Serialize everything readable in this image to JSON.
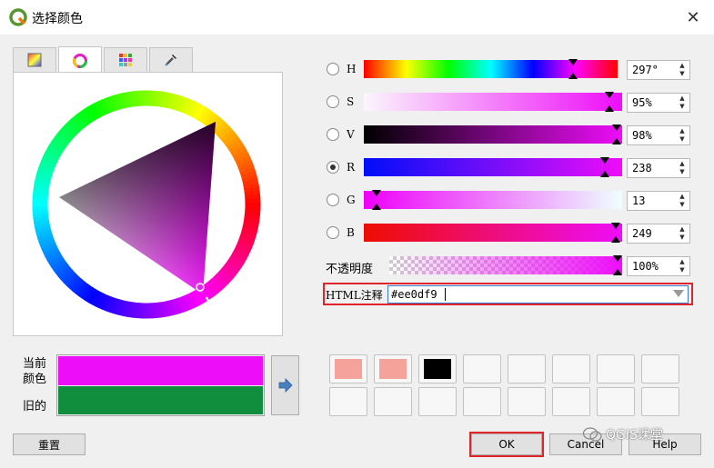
{
  "window": {
    "title": "选择颜色",
    "close_glyph": "✕"
  },
  "tabs": [
    {
      "name": "tab-ramp",
      "icon": "color-ramp-icon"
    },
    {
      "name": "tab-wheel",
      "icon": "color-wheel-icon",
      "active": true
    },
    {
      "name": "tab-swatches",
      "icon": "swatch-grid-icon"
    },
    {
      "name": "tab-picker",
      "icon": "eyedropper-icon"
    }
  ],
  "components": [
    {
      "key": "h",
      "label": "H",
      "value": "297°",
      "checked": false,
      "marker_fraction": 0.825
    },
    {
      "key": "s",
      "label": "S",
      "value": "95%",
      "checked": false,
      "marker_fraction": 0.95
    },
    {
      "key": "v",
      "label": "V",
      "value": "98%",
      "checked": false,
      "marker_fraction": 0.98
    },
    {
      "key": "r",
      "label": "R",
      "value": "238",
      "checked": true,
      "marker_fraction": 0.933
    },
    {
      "key": "g",
      "label": "G",
      "value": "13",
      "checked": false,
      "marker_fraction": 0.051
    },
    {
      "key": "b",
      "label": "B",
      "value": "249",
      "checked": false,
      "marker_fraction": 0.976
    }
  ],
  "opacity": {
    "label": "不透明度",
    "value": "100%",
    "fraction": 1.0
  },
  "html": {
    "label": "HTML注释",
    "value": "#ee0df9"
  },
  "preview": {
    "current_label_line1": "当前",
    "current_label_line2": "颜色",
    "old_label": "旧的",
    "current_color": "#ee0df9",
    "old_color": "#118d3e"
  },
  "arrow_button": {
    "icon": "arrow-right-icon"
  },
  "recent_swatches": [
    "#f5a29a",
    "#f5a29a",
    "#000000",
    "",
    "",
    "",
    "",
    "",
    "",
    "",
    "",
    "",
    "",
    "",
    "",
    ""
  ],
  "buttons": {
    "reset": "重置",
    "ok": "OK",
    "cancel": "Cancel",
    "help": "Help"
  },
  "watermark": "QGIS课堂",
  "colors": {
    "accent_highlight": "#e0242c"
  }
}
